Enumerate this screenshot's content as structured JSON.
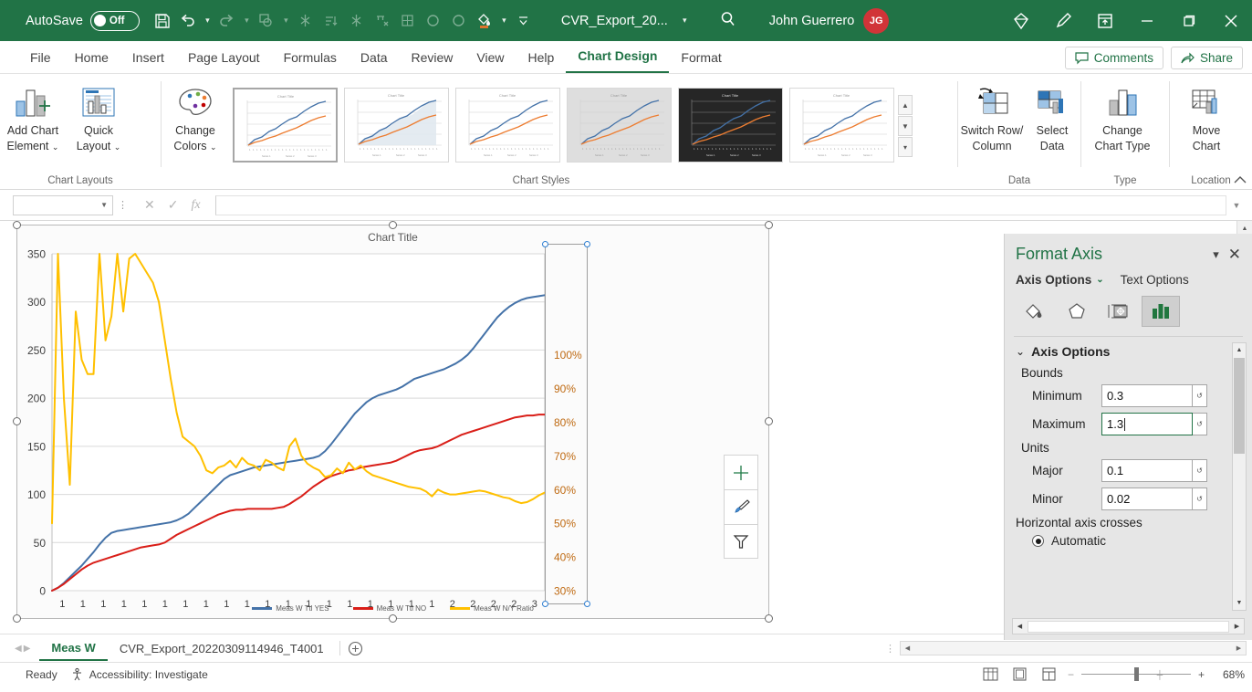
{
  "titlebar": {
    "autosave_label": "AutoSave",
    "autosave_state": "Off",
    "document_name": "CVR_Export_20...",
    "user_name": "John Guerrero",
    "user_initials": "JG",
    "qat_icons": [
      "save-icon",
      "undo-icon",
      "redo-icon",
      "new-comment-icon",
      "freeze-icon",
      "sort-asc-icon",
      "sort-desc-icon",
      "filter-clear-icon",
      "borders-icon",
      "circle-icon",
      "circle-filled-icon",
      "fill-color-icon",
      "customize-qat-icon"
    ],
    "search_icon": "search-icon",
    "diamond_icon": "diamond-icon",
    "pen_icon": "pen-icon",
    "ribbon_display_icon": "ribbon-display-icon",
    "minimize": "minimize-icon",
    "restore": "restore-icon",
    "close": "close-icon"
  },
  "ribbon": {
    "tabs": [
      "File",
      "Home",
      "Insert",
      "Page Layout",
      "Formulas",
      "Data",
      "Review",
      "View",
      "Help",
      "Chart Design",
      "Format"
    ],
    "active_tab": "Chart Design",
    "comments_label": "Comments",
    "share_label": "Share",
    "groups": [
      {
        "name": "Chart Layouts",
        "buttons": [
          {
            "label_line1": "Add Chart",
            "label_line2": "Element",
            "icon": "add-chart-element-icon",
            "dropdown": true
          },
          {
            "label_line1": "Quick",
            "label_line2": "Layout",
            "icon": "quick-layout-icon",
            "dropdown": true
          }
        ]
      },
      {
        "name": "Chart Styles",
        "buttons": [
          {
            "label_line1": "Change",
            "label_line2": "Colors",
            "icon": "change-colors-icon",
            "dropdown": true
          }
        ]
      },
      {
        "name": "Data",
        "buttons": [
          {
            "label_line1": "Switch Row/",
            "label_line2": "Column",
            "icon": "switch-row-column-icon",
            "dropdown": false
          },
          {
            "label_line1": "Select",
            "label_line2": "Data",
            "icon": "select-data-icon",
            "dropdown": false
          }
        ]
      },
      {
        "name": "Type",
        "buttons": [
          {
            "label_line1": "Change",
            "label_line2": "Chart Type",
            "icon": "change-chart-type-icon",
            "dropdown": false
          }
        ]
      },
      {
        "name": "Location",
        "buttons": [
          {
            "label_line1": "Move",
            "label_line2": "Chart",
            "icon": "move-chart-icon",
            "dropdown": false
          }
        ]
      }
    ],
    "style_thumbnails": [
      {
        "name": "style-1",
        "selected": true,
        "bg": "#ffffff",
        "fill": false,
        "dark": false
      },
      {
        "name": "style-2",
        "selected": false,
        "bg": "#ffffff",
        "fill": true,
        "dark": false
      },
      {
        "name": "style-3",
        "selected": false,
        "bg": "#ffffff",
        "fill": false,
        "dark": false
      },
      {
        "name": "style-4",
        "selected": false,
        "bg": "#dedede",
        "fill": false,
        "dark": false
      },
      {
        "name": "style-5",
        "selected": false,
        "bg": "#262626",
        "fill": false,
        "dark": true
      },
      {
        "name": "style-6",
        "selected": false,
        "bg": "#ffffff",
        "fill": false,
        "dark": false
      }
    ]
  },
  "formulabar": {
    "namebox_value": "",
    "cancel_icon": "cancel-icon",
    "enter_icon": "confirm-icon",
    "fx_label": "fx",
    "formula_value": ""
  },
  "chart_data": {
    "type": "line",
    "title": "Chart Title",
    "xlabel": "",
    "ylabel": "",
    "ylim": [
      0,
      350
    ],
    "y2lim": [
      0.3,
      1.3
    ],
    "grid": true,
    "legend_position": "bottom",
    "y_ticks": [
      "0",
      "50",
      "100",
      "150",
      "200",
      "250",
      "300",
      "350"
    ],
    "y2_ticks": [
      "30%",
      "40%",
      "50%",
      "60%",
      "70%",
      "80%",
      "90%",
      "100%"
    ],
    "x_ticks": [
      "1",
      "1",
      "1",
      "1",
      "1",
      "1",
      "1",
      "1",
      "1",
      "1",
      "1",
      "1",
      "1",
      "1",
      "1",
      "1",
      "1",
      "1",
      "1",
      "2",
      "2",
      "2",
      "2",
      "3"
    ],
    "series": [
      {
        "name": "Meas W Ttl YES",
        "color": "#4472a8",
        "axis": "primary",
        "values": [
          0,
          3,
          8,
          14,
          20,
          26,
          33,
          40,
          48,
          55,
          60,
          62,
          63,
          64,
          65,
          66,
          67,
          68,
          69,
          70,
          71,
          73,
          76,
          80,
          86,
          92,
          98,
          104,
          110,
          116,
          120,
          122,
          124,
          126,
          128,
          129,
          130,
          131,
          132,
          133,
          134,
          135,
          136,
          137,
          138,
          140,
          145,
          152,
          160,
          168,
          176,
          184,
          190,
          196,
          200,
          203,
          205,
          207,
          209,
          212,
          216,
          220,
          222,
          224,
          226,
          228,
          230,
          233,
          236,
          240,
          245,
          252,
          260,
          268,
          276,
          284,
          290,
          295,
          299,
          302,
          304,
          305,
          306,
          307
        ]
      },
      {
        "name": "Meas W Ttl NO",
        "color": "#d91e18",
        "axis": "primary",
        "values": [
          0,
          3,
          7,
          12,
          17,
          22,
          26,
          29,
          31,
          33,
          35,
          37,
          39,
          41,
          43,
          45,
          46,
          47,
          48,
          50,
          54,
          58,
          61,
          64,
          67,
          70,
          73,
          76,
          79,
          81,
          83,
          84,
          84,
          85,
          85,
          85,
          85,
          85,
          86,
          87,
          90,
          94,
          98,
          103,
          108,
          112,
          116,
          119,
          121,
          123,
          125,
          126,
          128,
          129,
          130,
          131,
          132,
          133,
          135,
          138,
          141,
          144,
          146,
          147,
          148,
          150,
          153,
          156,
          159,
          162,
          164,
          166,
          168,
          170,
          172,
          174,
          176,
          178,
          180,
          181,
          182,
          182,
          183,
          183
        ]
      },
      {
        "name": "Meas W N/Y Ratio",
        "color": "#ffc000",
        "axis": "secondary",
        "values": [
          70,
          350,
          200,
          110,
          290,
          240,
          225,
          225,
          350,
          260,
          285,
          350,
          290,
          345,
          350,
          340,
          330,
          320,
          300,
          260,
          220,
          185,
          160,
          155,
          150,
          140,
          125,
          122,
          128,
          130,
          135,
          128,
          138,
          132,
          130,
          125,
          136,
          133,
          128,
          125,
          150,
          158,
          140,
          132,
          128,
          125,
          118,
          120,
          127,
          122,
          133,
          126,
          130,
          124,
          120,
          118,
          116,
          114,
          112,
          110,
          108,
          107,
          106,
          103,
          98,
          105,
          102,
          100,
          100,
          101,
          102,
          103,
          104,
          103,
          101,
          99,
          97,
          96,
          93,
          91,
          92,
          95,
          99,
          102
        ]
      }
    ]
  },
  "chart_overlay": {
    "buttons": [
      {
        "name": "chart-elements-button",
        "icon": "plus-icon"
      },
      {
        "name": "chart-styles-button",
        "icon": "brush-icon"
      },
      {
        "name": "chart-filters-button",
        "icon": "funnel-icon"
      }
    ]
  },
  "taskpane": {
    "title": "Format Axis",
    "pane_options_icon": "pane-options-icon",
    "close_icon": "close-icon",
    "tabs": [
      {
        "label": "Axis Options",
        "active": true,
        "has_caret": true
      },
      {
        "label": "Text Options",
        "active": false,
        "has_caret": false
      }
    ],
    "icon_tabs": [
      {
        "name": "fill-line-icon",
        "selected": false
      },
      {
        "name": "effects-icon",
        "selected": false
      },
      {
        "name": "size-properties-icon",
        "selected": false
      },
      {
        "name": "axis-options-chart-icon",
        "selected": true
      }
    ],
    "section_label": "Axis Options",
    "bounds_label": "Bounds",
    "units_label": "Units",
    "crosses_label": "Horizontal axis crosses",
    "fields": [
      {
        "label": "Minimum",
        "value": "0.3",
        "focused": false,
        "name": "minimum-field"
      },
      {
        "label": "Maximum",
        "value": "1.3",
        "focused": true,
        "name": "maximum-field"
      },
      {
        "label": "Major",
        "value": "0.1",
        "focused": false,
        "name": "major-unit-field"
      },
      {
        "label": "Minor",
        "value": "0.02",
        "focused": false,
        "name": "minor-unit-field"
      }
    ],
    "automatic_label": "Automatic"
  },
  "sheettabs": {
    "tabs": [
      {
        "label": "Meas W",
        "active": true
      },
      {
        "label": "CVR_Export_20220309114946_T4001",
        "active": false
      }
    ],
    "add_label": "+"
  },
  "statusbar": {
    "ready_label": "Ready",
    "accessibility_label": "Accessibility: Investigate",
    "zoom_value": "68%",
    "views": [
      "normal-view-icon",
      "page-layout-view-icon",
      "page-break-view-icon"
    ]
  },
  "colors": {
    "excel_green": "#217346",
    "series_blue": "#4472a8",
    "series_red": "#d91e18",
    "series_yellow": "#ffc000",
    "secondary_axis_text": "#bf6a12"
  }
}
